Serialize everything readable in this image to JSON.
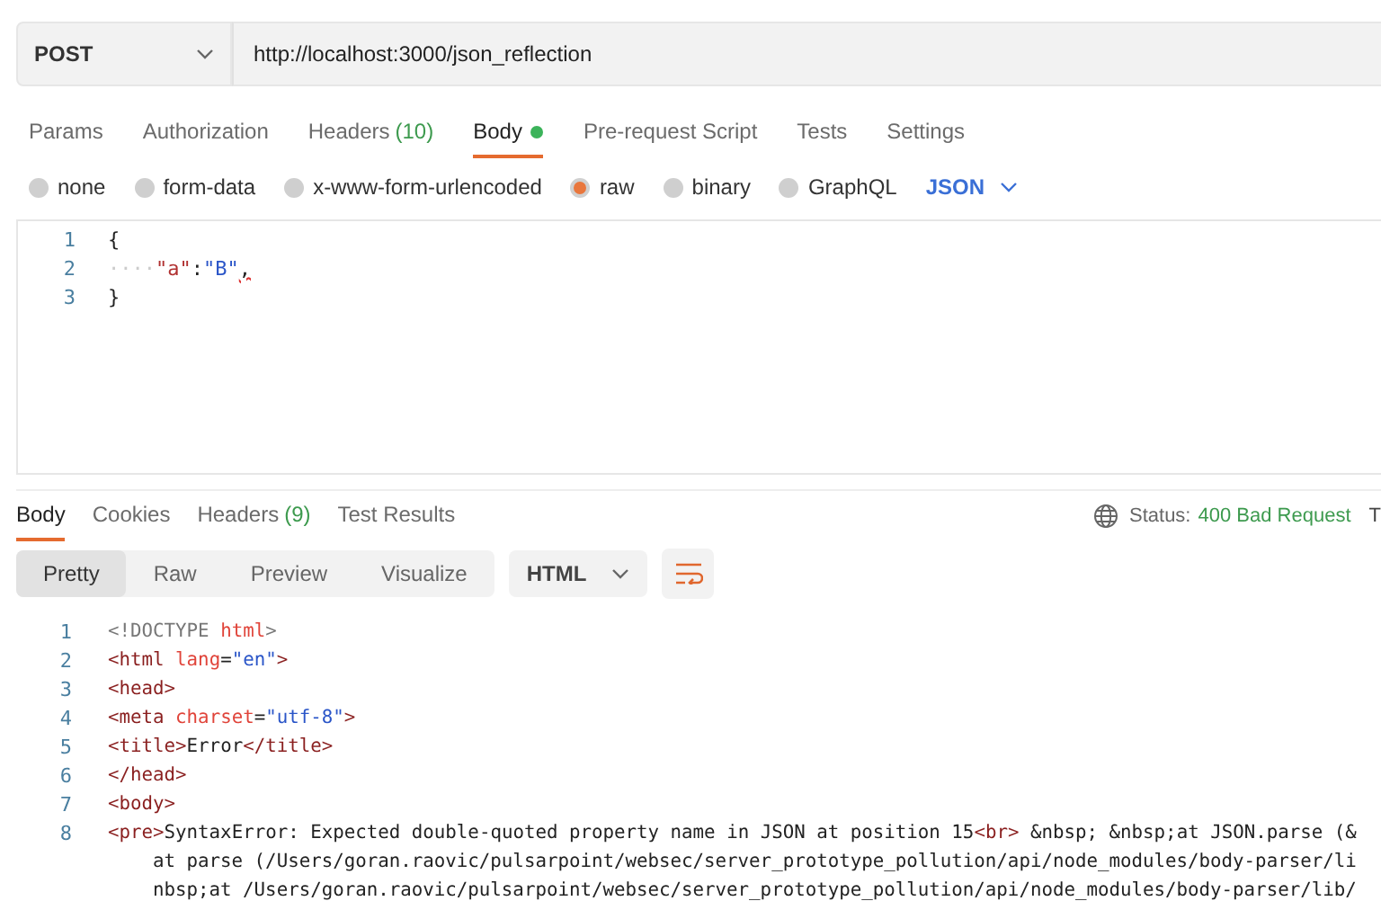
{
  "request": {
    "method": "POST",
    "url": "http://localhost:3000/json_reflection"
  },
  "request_tabs": [
    {
      "label": "Params",
      "dot": false,
      "selected": false
    },
    {
      "label": "Authorization",
      "dot": false,
      "selected": false
    },
    {
      "label": "Headers",
      "count": "(10)",
      "dot": false,
      "selected": false
    },
    {
      "label": "Body",
      "dot": true,
      "selected": true
    },
    {
      "label": "Pre-request Script",
      "dot": false,
      "selected": false
    },
    {
      "label": "Tests",
      "dot": false,
      "selected": false
    },
    {
      "label": "Settings",
      "dot": false,
      "selected": false
    }
  ],
  "body_types": [
    {
      "label": "none",
      "selected": false
    },
    {
      "label": "form-data",
      "selected": false
    },
    {
      "label": "x-www-form-urlencoded",
      "selected": false
    },
    {
      "label": "raw",
      "selected": true
    },
    {
      "label": "binary",
      "selected": false
    },
    {
      "label": "GraphQL",
      "selected": false
    }
  ],
  "raw_format": "JSON",
  "editor_lines": [
    {
      "number": "1",
      "tokens": [
        {
          "kind": "punct",
          "text": "{"
        }
      ]
    },
    {
      "number": "2",
      "tokens": [
        {
          "kind": "ws",
          "text": "····"
        },
        {
          "kind": "key",
          "text": "\"a\""
        },
        {
          "kind": "punct",
          "text": ":"
        },
        {
          "kind": "str",
          "text": "\"B\""
        },
        {
          "kind": "error",
          "text": ","
        }
      ]
    },
    {
      "number": "3",
      "tokens": [
        {
          "kind": "punct",
          "text": "}"
        }
      ]
    }
  ],
  "response_tabs": [
    {
      "label": "Body",
      "selected": true
    },
    {
      "label": "Cookies",
      "selected": false
    },
    {
      "label": "Headers",
      "count": "(9)",
      "selected": false
    },
    {
      "label": "Test Results",
      "selected": false
    }
  ],
  "status": {
    "label": "Status:",
    "value": "400 Bad Request",
    "next": "T"
  },
  "view_modes": [
    {
      "label": "Pretty",
      "selected": true
    },
    {
      "label": "Raw",
      "selected": false
    },
    {
      "label": "Preview",
      "selected": false
    },
    {
      "label": "Visualize",
      "selected": false
    }
  ],
  "response_format": "HTML",
  "response_lines": [
    {
      "number": "1",
      "tokens": [
        {
          "kind": "doctype",
          "text": "<!DOCTYPE "
        },
        {
          "kind": "attr",
          "text": "html"
        },
        {
          "kind": "doctype",
          "text": ">"
        }
      ]
    },
    {
      "number": "2",
      "tokens": [
        {
          "kind": "tag",
          "text": "<html "
        },
        {
          "kind": "attr",
          "text": "lang"
        },
        {
          "kind": "punct",
          "text": "="
        },
        {
          "kind": "str",
          "text": "\"en\""
        },
        {
          "kind": "tag",
          "text": ">"
        }
      ]
    },
    {
      "number": "3",
      "tokens": [
        {
          "kind": "tag",
          "text": "<head>"
        }
      ]
    },
    {
      "number": "4",
      "tokens": [
        {
          "kind": "tag",
          "text": "<meta "
        },
        {
          "kind": "attr",
          "text": "charset"
        },
        {
          "kind": "punct",
          "text": "="
        },
        {
          "kind": "str",
          "text": "\"utf-8\""
        },
        {
          "kind": "tag",
          "text": ">"
        }
      ]
    },
    {
      "number": "5",
      "tokens": [
        {
          "kind": "tag",
          "text": "<title>"
        },
        {
          "kind": "text",
          "text": "Error"
        },
        {
          "kind": "tag",
          "text": "</title>"
        }
      ]
    },
    {
      "number": "6",
      "tokens": [
        {
          "kind": "tag",
          "text": "</head>"
        }
      ]
    },
    {
      "number": "7",
      "tokens": [
        {
          "kind": "tag",
          "text": "<body>"
        }
      ]
    },
    {
      "number": "8",
      "tokens": [
        {
          "kind": "tag",
          "text": "<pre>"
        },
        {
          "kind": "text",
          "text": "SyntaxError: Expected double-quoted property name in JSON at position 15"
        },
        {
          "kind": "tag",
          "text": "<br>"
        },
        {
          "kind": "text",
          "text": " &nbsp; &nbsp;at JSON.parse (&"
        }
      ],
      "continuations": [
        "at parse (/Users/goran.raovic/pulsarpoint/websec/server_prototype_pollution/api/node_modules/body-parser/li",
        "nbsp;at /Users/goran.raovic/pulsarpoint/websec/server_prototype_pollution/api/node_modules/body-parser/lib/"
      ]
    }
  ]
}
